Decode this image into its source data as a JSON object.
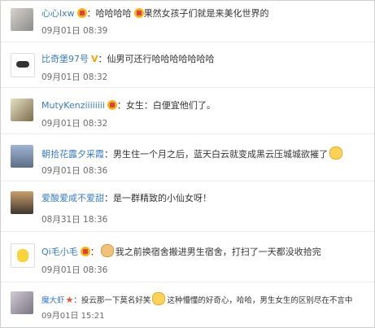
{
  "comments": [
    {
      "user": "心心lxw",
      "colon": "：",
      "text_a": "哈哈哈哈",
      "text_b": "果然女孩子们就是来美化世界的",
      "time": "09月01日 08:39"
    },
    {
      "user": "比奇堡97号",
      "colon": "：",
      "text_a": "仙男可还行哈哈哈哈哈哈哈",
      "text_b": "",
      "time": "09月01日 08:32"
    },
    {
      "user": "MutyKenziiiiiiii",
      "colon": "：",
      "text_a": "女生：白便宜他们了。",
      "text_b": "",
      "time": "09月01日 08:32"
    },
    {
      "user": "朝拾花露夕采霞",
      "colon": "：",
      "text_a": "男生住一个月之后，蓝天白云就变成黑云压城城欲摧了",
      "text_b": "",
      "time": "09月01日 08:36"
    },
    {
      "user": "爱酸爱咸不爱甜",
      "colon": "：",
      "text_a": "是一群精致的小仙女呀！",
      "text_b": "",
      "time": "08月31日 18:36"
    },
    {
      "user": "Qi毛小毛",
      "colon": "：",
      "text_a": "我之前换宿舍搬进男生宿舍，打扫了一天都没收拾完",
      "text_b": "",
      "time": "09月01日 08:36"
    },
    {
      "user": "魔大虾",
      "colon": "：",
      "text_a": "投云那一下莫名好笑",
      "text_b": "这种懵懂的好奇心，哈哈，男生女生的区别尽在不言中",
      "time": "09月01日 15:21"
    }
  ],
  "colors": {
    "link": "#3b7bbf",
    "text": "#333333",
    "time": "#6b6b6b",
    "badge": "#f7b21a"
  }
}
